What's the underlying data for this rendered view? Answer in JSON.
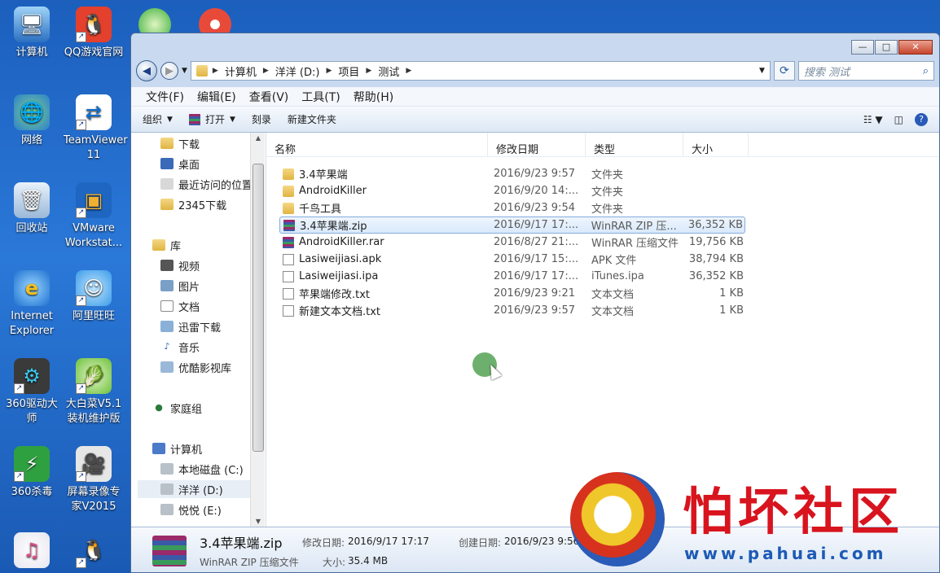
{
  "desktop": {
    "icons": [
      {
        "label": "计算机",
        "icon": "computer-icon"
      },
      {
        "label": "QQ游戏官网",
        "icon": "qq-game-icon"
      },
      {
        "label": "网络",
        "icon": "network-icon"
      },
      {
        "label": "TeamViewer 11",
        "icon": "teamviewer-icon"
      },
      {
        "label": "回收站",
        "icon": "recycle-bin-icon"
      },
      {
        "label": "VMware Workstat...",
        "icon": "vmware-icon"
      },
      {
        "label": "Internet Explorer",
        "icon": "ie-icon"
      },
      {
        "label": "阿里旺旺",
        "icon": "aliwangwang-icon"
      },
      {
        "label": "360驱动大师",
        "icon": "360-driver-icon"
      },
      {
        "label": "大白菜V5.1装机维护版",
        "icon": "dabaicai-icon"
      },
      {
        "label": "360杀毒",
        "icon": "360-antivirus-icon"
      },
      {
        "label": "屏幕录像专家V2015",
        "icon": "screen-recorder-icon"
      }
    ]
  },
  "window": {
    "caption": {
      "minimize": "—",
      "maximize": "□",
      "close": "✕"
    },
    "breadcrumb": [
      "计算机",
      "洋洋 (D:)",
      "项目",
      "测试"
    ],
    "search_placeholder": "搜索 测试",
    "menu": [
      "文件(F)",
      "编辑(E)",
      "查看(V)",
      "工具(T)",
      "帮助(H)"
    ],
    "toolbar": {
      "organize": "组织",
      "open": "打开",
      "burn": "刻录",
      "new_folder": "新建文件夹"
    },
    "nav": [
      {
        "label": "下载",
        "type": "folder"
      },
      {
        "label": "桌面",
        "type": "desktop"
      },
      {
        "label": "最近访问的位置",
        "type": "recent"
      },
      {
        "label": "2345下载",
        "type": "folder"
      },
      {
        "label": "库",
        "type": "library"
      },
      {
        "label": "视频",
        "type": "video"
      },
      {
        "label": "图片",
        "type": "picture"
      },
      {
        "label": "文档",
        "type": "document"
      },
      {
        "label": "迅雷下载",
        "type": "thunder"
      },
      {
        "label": "音乐",
        "type": "music"
      },
      {
        "label": "优酷影视库",
        "type": "youku"
      },
      {
        "label": "家庭组",
        "type": "homegroup"
      },
      {
        "label": "计算机",
        "type": "computer"
      },
      {
        "label": "本地磁盘 (C:)",
        "type": "drive"
      },
      {
        "label": "洋洋 (D:)",
        "type": "drive"
      },
      {
        "label": "悦悦 (E:)",
        "type": "drive"
      }
    ],
    "columns": [
      "名称",
      "修改日期",
      "类型",
      "大小"
    ],
    "files": [
      {
        "name": "3.4苹果端",
        "date": "2016/9/23 9:57",
        "type": "文件夹",
        "size": "",
        "icon": "folder"
      },
      {
        "name": "AndroidKiller",
        "date": "2016/9/20 14:...",
        "type": "文件夹",
        "size": "",
        "icon": "folder"
      },
      {
        "name": "千鸟工具",
        "date": "2016/9/23 9:54",
        "type": "文件夹",
        "size": "",
        "icon": "folder"
      },
      {
        "name": "3.4苹果端.zip",
        "date": "2016/9/17 17:...",
        "type": "WinRAR ZIP 压...",
        "size": "36,352 KB",
        "icon": "rar"
      },
      {
        "name": "AndroidKiller.rar",
        "date": "2016/8/27 21:...",
        "type": "WinRAR 压缩文件",
        "size": "19,756 KB",
        "icon": "rar"
      },
      {
        "name": "Lasiweijiasi.apk",
        "date": "2016/9/17 15:...",
        "type": "APK 文件",
        "size": "38,794 KB",
        "icon": "doc"
      },
      {
        "name": "Lasiweijiasi.ipa",
        "date": "2016/9/17 17:...",
        "type": "iTunes.ipa",
        "size": "36,352 KB",
        "icon": "doc"
      },
      {
        "name": "苹果端修改.txt",
        "date": "2016/9/23 9:21",
        "type": "文本文档",
        "size": "1 KB",
        "icon": "doc"
      },
      {
        "name": "新建文本文档.txt",
        "date": "2016/9/23 9:57",
        "type": "文本文档",
        "size": "1 KB",
        "icon": "doc"
      }
    ],
    "details": {
      "name": "3.4苹果端.zip",
      "type": "WinRAR ZIP 压缩文件",
      "modified_label": "修改日期:",
      "modified": "2016/9/17 17:17",
      "created_label": "创建日期:",
      "created": "2016/9/23 9:56",
      "size_label": "大小:",
      "size": "35.4 MB"
    }
  },
  "watermark": {
    "text": "怕坏社区",
    "url": "www.pahuai.com"
  }
}
